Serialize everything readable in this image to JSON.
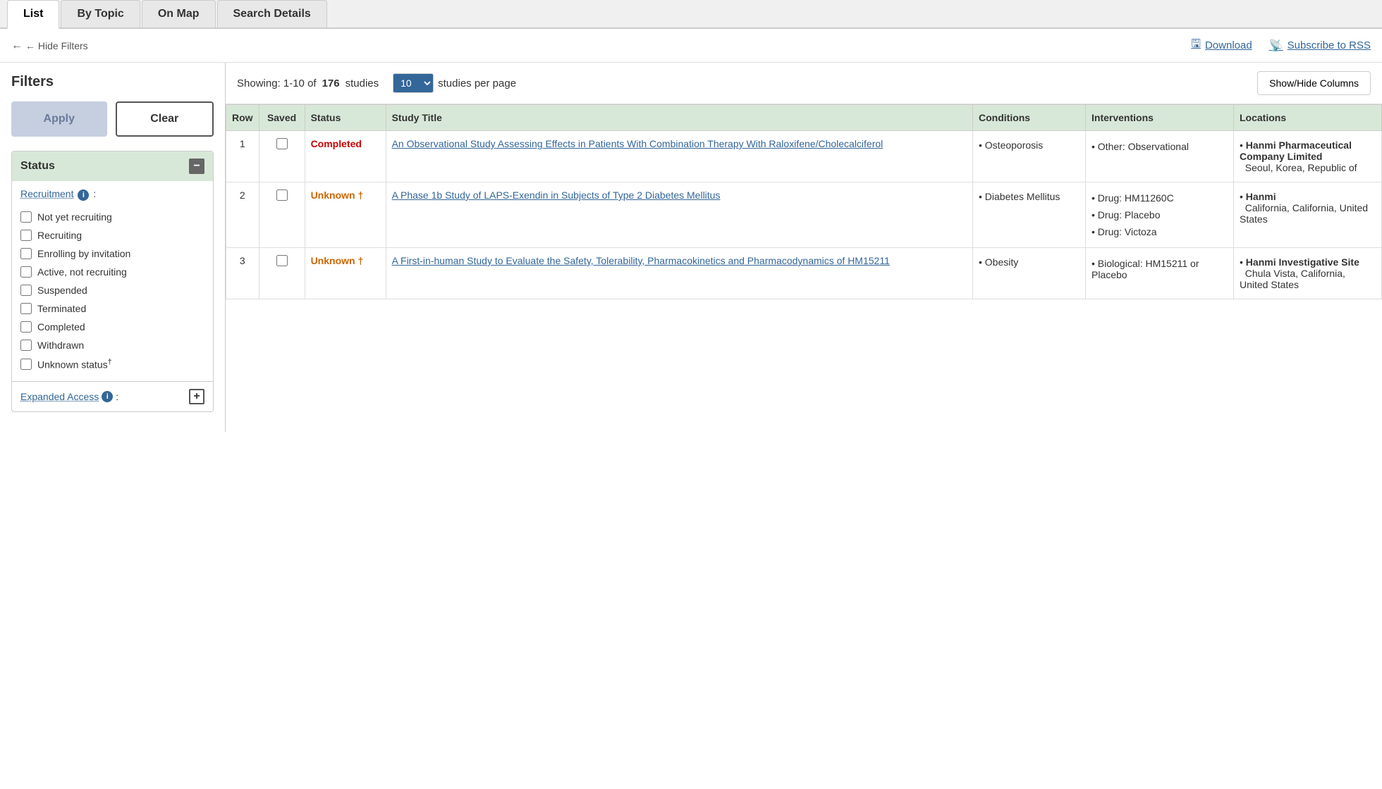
{
  "tabs": [
    {
      "id": "list",
      "label": "List",
      "active": true
    },
    {
      "id": "by-topic",
      "label": "By Topic",
      "active": false
    },
    {
      "id": "on-map",
      "label": "On Map",
      "active": false
    },
    {
      "id": "search-details",
      "label": "Search Details",
      "active": false
    }
  ],
  "action_bar": {
    "hide_filters_label": "← Hide Filters",
    "download_label": "Download",
    "rss_label": "Subscribe to RSS"
  },
  "filters": {
    "title": "Filters",
    "apply_label": "Apply",
    "clear_label": "Clear",
    "status_section": {
      "label": "Status",
      "recruitment_label": "Recruitment",
      "items": [
        {
          "id": "not-yet",
          "label": "Not yet recruiting",
          "checked": false
        },
        {
          "id": "recruiting",
          "label": "Recruiting",
          "checked": false
        },
        {
          "id": "enrolling",
          "label": "Enrolling by invitation",
          "checked": false
        },
        {
          "id": "active",
          "label": "Active, not recruiting",
          "checked": false
        },
        {
          "id": "suspended",
          "label": "Suspended",
          "checked": false
        },
        {
          "id": "terminated",
          "label": "Terminated",
          "checked": false
        },
        {
          "id": "completed",
          "label": "Completed",
          "checked": false
        },
        {
          "id": "withdrawn",
          "label": "Withdrawn",
          "checked": false
        },
        {
          "id": "unknown",
          "label": "Unknown status†",
          "checked": false
        }
      ]
    },
    "expanded_access_label": "Expanded Access"
  },
  "results": {
    "showing_prefix": "Showing: 1-10 of ",
    "total": "176",
    "showing_suffix": " studies",
    "per_page_value": "10",
    "per_page_label": "studies per page",
    "show_hide_columns_label": "Show/Hide Columns"
  },
  "table": {
    "headers": [
      "Row",
      "Saved",
      "Status",
      "Study Title",
      "Conditions",
      "Interventions",
      "Locations"
    ],
    "rows": [
      {
        "row": "1",
        "status": "Completed",
        "status_class": "completed",
        "title": "An Observational Study Assessing Effects in Patients With Combination Therapy With Raloxifene/Cholecalciferol",
        "conditions": [
          "Osteoporosis"
        ],
        "interventions": [
          "Other: Observational"
        ],
        "location_name": "Hanmi Pharmaceutical Company Limited",
        "location_detail": "Seoul, Korea, Republic of"
      },
      {
        "row": "2",
        "status": "Unknown †",
        "status_class": "unknown",
        "title": "A Phase 1b Study of LAPS-Exendin in Subjects of Type 2 Diabetes Mellitus",
        "conditions": [
          "Diabetes Mellitus"
        ],
        "interventions": [
          "Drug: HM11260C",
          "Drug: Placebo",
          "Drug: Victoza"
        ],
        "location_name": "Hanmi",
        "location_detail": "California, California, United States"
      },
      {
        "row": "3",
        "status": "Unknown †",
        "status_class": "unknown",
        "title": "A First-in-human Study to Evaluate the Safety, Tolerability, Pharmacokinetics and Pharmacodynamics of HM15211",
        "conditions": [
          "Obesity"
        ],
        "interventions": [
          "Biological: HM15211 or Placebo"
        ],
        "location_name": "Hanmi Investigative Site",
        "location_detail": "Chula Vista, California, United States"
      }
    ]
  }
}
